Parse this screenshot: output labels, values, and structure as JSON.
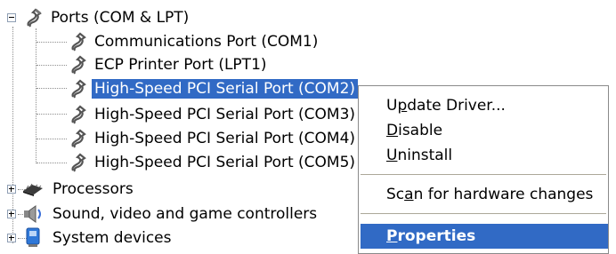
{
  "tree": {
    "ports": {
      "label": "Ports (COM & LPT)",
      "children": [
        {
          "label": "Communications Port (COM1)"
        },
        {
          "label": "ECP Printer Port (LPT1)"
        },
        {
          "label": "High-Speed PCI  Serial Port (COM2)"
        },
        {
          "label": "High-Speed PCI  Serial Port (COM3)"
        },
        {
          "label": "High-Speed PCI  Serial Port (COM4)"
        },
        {
          "label": "High-Speed PCI  Serial Port (COM5)"
        }
      ]
    },
    "processors": {
      "label": "Processors"
    },
    "sound": {
      "label": "Sound, video and game controllers"
    },
    "system": {
      "label": "System devices"
    }
  },
  "context_menu": {
    "update_driver": {
      "pre": "U",
      "key": "p",
      "post": "date Driver..."
    },
    "disable": {
      "pre": "",
      "key": "D",
      "post": "isable"
    },
    "uninstall": {
      "pre": "",
      "key": "U",
      "post": "ninstall"
    },
    "scan": {
      "pre": "Sc",
      "key": "a",
      "post": "n for hardware changes"
    },
    "properties": {
      "pre": "",
      "key": "P",
      "post": "roperties"
    }
  },
  "colors": {
    "selection": "#316ac5",
    "menu_border": "#8a8a8a"
  }
}
